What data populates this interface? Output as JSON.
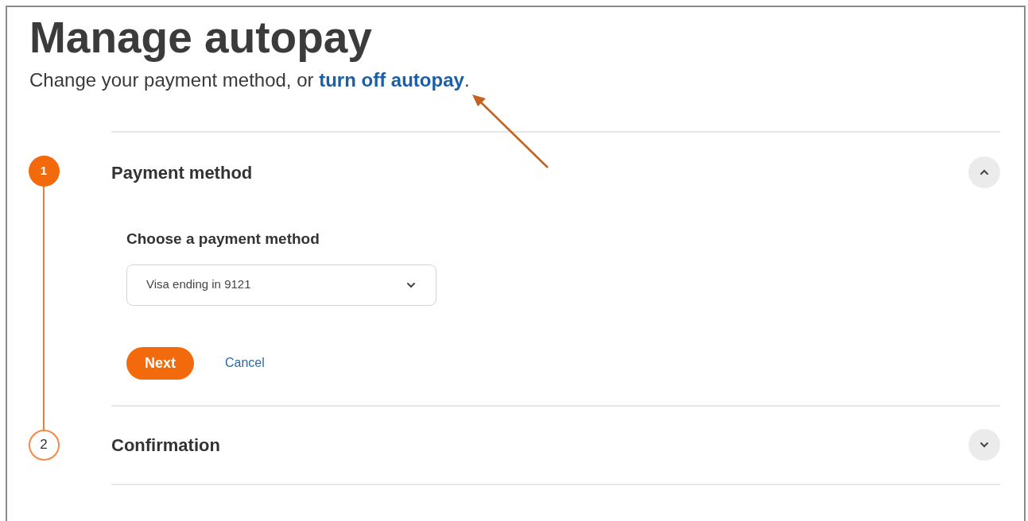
{
  "title": "Manage autopay",
  "subtitle": {
    "text": "Change your payment method, or ",
    "link": "turn off autopay",
    "end": "."
  },
  "steps": [
    {
      "number": "1",
      "title": "Payment method",
      "active": true,
      "expanded": true,
      "content": {
        "label": "Choose a payment method",
        "select_value": "Visa ending in 9121",
        "primary_button": "Next",
        "secondary_link": "Cancel"
      }
    },
    {
      "number": "2",
      "title": "Confirmation",
      "active": false,
      "expanded": false
    }
  ]
}
